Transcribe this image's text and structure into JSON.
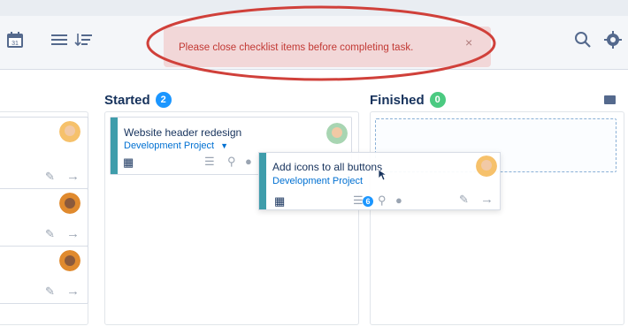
{
  "toast": {
    "message": "Please close checklist items before completing task.",
    "close_glyph": "×"
  },
  "toolbar": {
    "calendar_number": "31"
  },
  "columns": [
    {
      "title": "Started",
      "count": "2",
      "badge_color": "#1b96ff"
    },
    {
      "title": "Finished",
      "count": "0",
      "badge_color": "#4bca81"
    }
  ],
  "cards": {
    "started": {
      "title": "Website header redesign",
      "project": "Development Project"
    },
    "dragging": {
      "title": "Add icons to all buttons",
      "project": "Development Project",
      "checklist_count": "6"
    }
  },
  "colors": {
    "accent": "#3f9dab",
    "link": "#0070d2",
    "toast_bg": "#f2d7d8",
    "toast_text": "#c23934",
    "annotation": "#d0403a"
  },
  "icons": [
    "calendar-icon",
    "list-icon",
    "sort-icon",
    "search-icon",
    "gear-icon",
    "archive-icon",
    "pencil-icon",
    "arrow-right-icon",
    "checklist-icon",
    "paperclip-icon",
    "comment-icon",
    "chevron-down-icon",
    "cursor-icon"
  ]
}
